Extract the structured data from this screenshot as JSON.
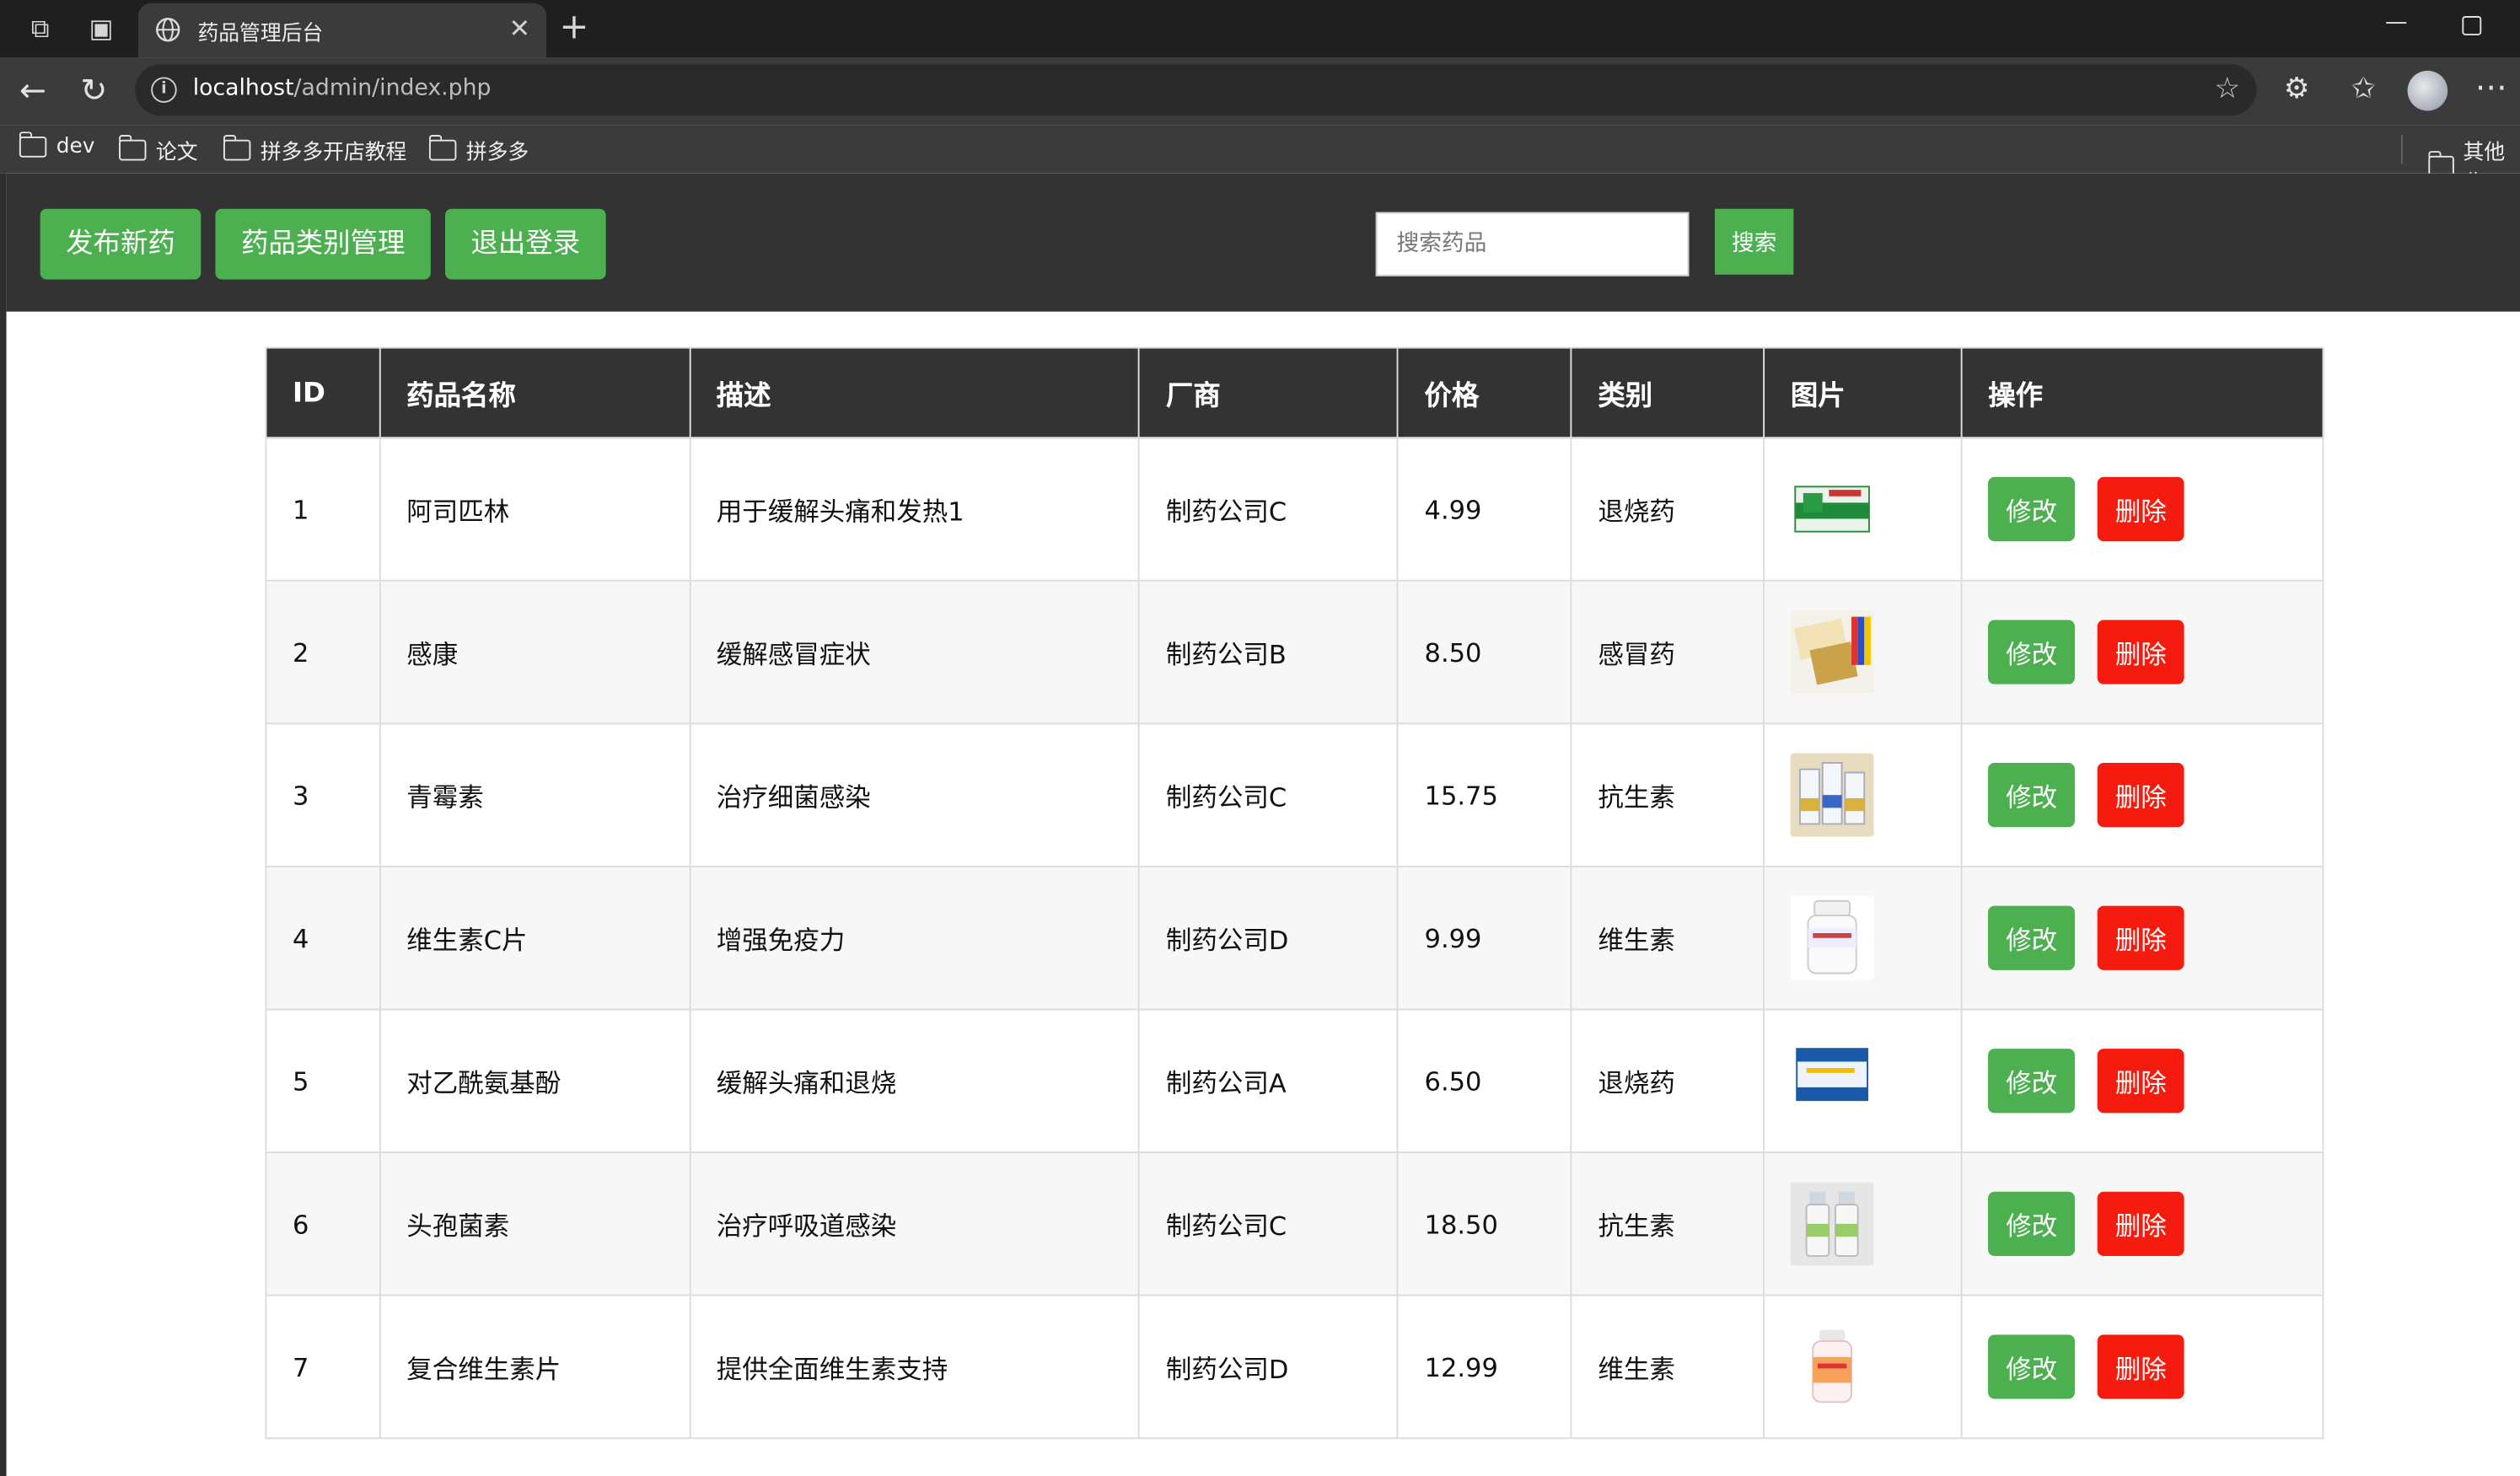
{
  "browser": {
    "tab_title": "药品管理后台",
    "url_host": "localhost",
    "url_path": "/admin/index.php",
    "bookmarks": [
      "dev",
      "论文",
      "拼多多开店教程",
      "拼多多"
    ],
    "bookmarks_other": "其他收"
  },
  "header": {
    "buttons": {
      "publish": "发布新药",
      "categories": "药品类别管理",
      "logout": "退出登录"
    },
    "search_placeholder": "搜索药品",
    "search_button": "搜索"
  },
  "table": {
    "columns": [
      "ID",
      "药品名称",
      "描述",
      "厂商",
      "价格",
      "类别",
      "图片",
      "操作"
    ],
    "edit_label": "修改",
    "delete_label": "删除",
    "rows": [
      {
        "id": "1",
        "name": "阿司匹林",
        "desc": "用于缓解头痛和发热1",
        "maker": "制药公司C",
        "price": "4.99",
        "category": "退烧药",
        "image_icon": "medicine-box-green-icon"
      },
      {
        "id": "2",
        "name": "感康",
        "desc": "缓解感冒症状",
        "maker": "制药公司B",
        "price": "8.50",
        "category": "感冒药",
        "image_icon": "medicine-packs-icon"
      },
      {
        "id": "3",
        "name": "青霉素",
        "desc": "治疗细菌感染",
        "maker": "制药公司C",
        "price": "15.75",
        "category": "抗生素",
        "image_icon": "vials-icon"
      },
      {
        "id": "4",
        "name": "维生素C片",
        "desc": "增强免疫力",
        "maker": "制药公司D",
        "price": "9.99",
        "category": "维生素",
        "image_icon": "white-bottle-icon"
      },
      {
        "id": "5",
        "name": "对乙酰氨基酚",
        "desc": "缓解头痛和退烧",
        "maker": "制药公司A",
        "price": "6.50",
        "category": "退烧药",
        "image_icon": "medicine-box-blue-icon"
      },
      {
        "id": "6",
        "name": "头孢菌素",
        "desc": "治疗呼吸道感染",
        "maker": "制药公司C",
        "price": "18.50",
        "category": "抗生素",
        "image_icon": "vials-pair-icon"
      },
      {
        "id": "7",
        "name": "复合维生素片",
        "desc": "提供全面维生素支持",
        "maker": "制药公司D",
        "price": "12.99",
        "category": "维生素",
        "image_icon": "pink-bottle-icon"
      }
    ]
  },
  "colors": {
    "header_bg": "#333333",
    "green": "#4caf50",
    "red": "#f51b0f"
  }
}
